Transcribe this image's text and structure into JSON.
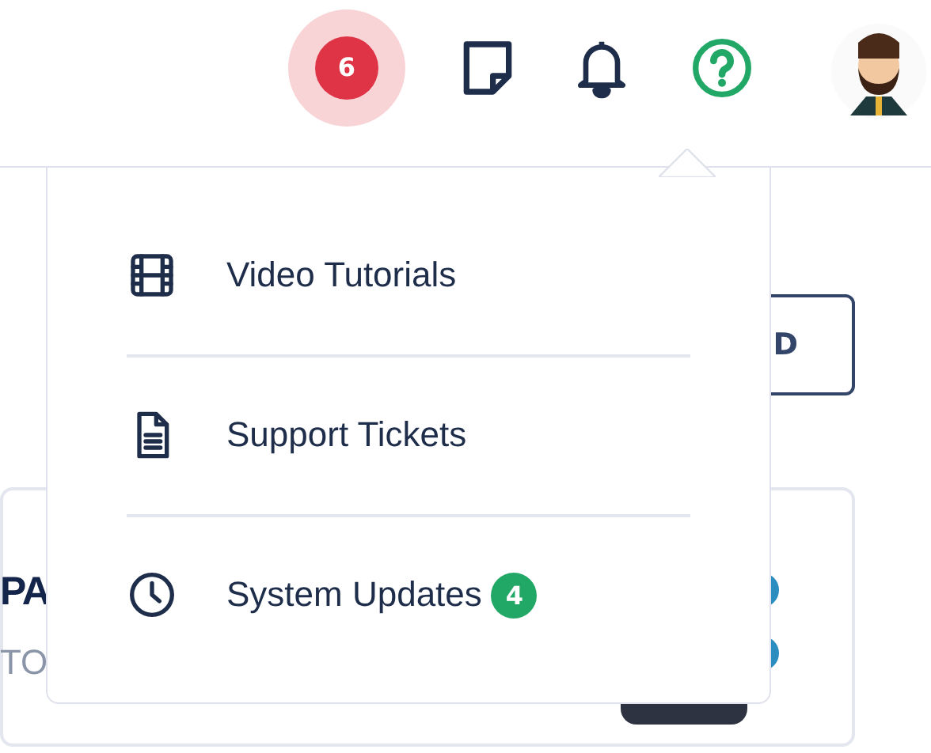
{
  "header": {
    "alert_count": "6"
  },
  "background": {
    "button_label": "D",
    "card_title": "PA",
    "card_subtitle": "TO"
  },
  "help_menu": {
    "items": [
      {
        "kind": "video",
        "label": "Video Tutorials"
      },
      {
        "kind": "ticket",
        "label": "Support Tickets"
      },
      {
        "kind": "clock",
        "label": "System Updates",
        "badge": "4"
      }
    ]
  }
}
